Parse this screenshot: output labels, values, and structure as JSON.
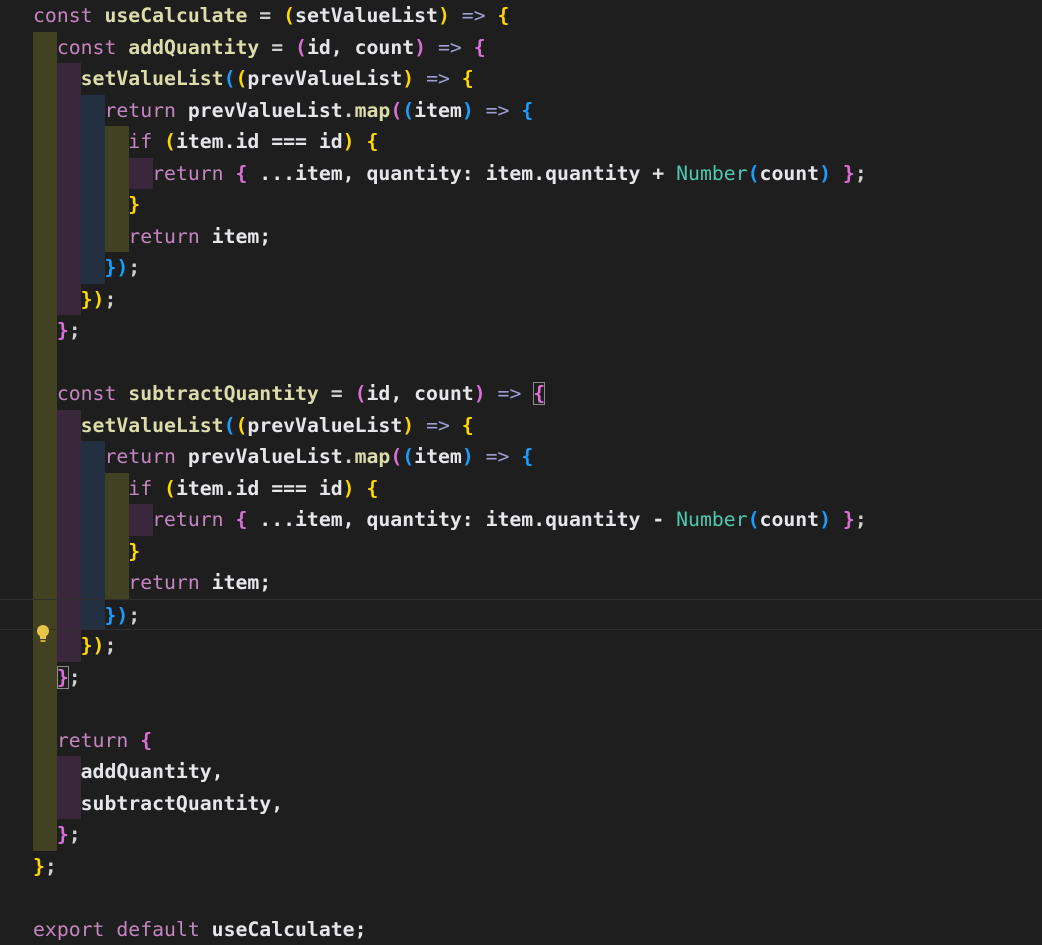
{
  "editor": {
    "lightbulb_icon": "lightbulb-icon",
    "current_line_index": 19,
    "lines": [
      [
        [
          "const ",
          "kw"
        ],
        [
          "useCalculate",
          "fn"
        ],
        [
          " = ",
          "op"
        ],
        [
          "(",
          "b1"
        ],
        [
          "setValueList",
          "id"
        ],
        [
          ")",
          "b1"
        ],
        [
          " => ",
          "arrow"
        ],
        [
          "{",
          "b1"
        ]
      ],
      [
        [
          "  ",
          "ws"
        ],
        [
          "const ",
          "kw"
        ],
        [
          "addQuantity",
          "fn"
        ],
        [
          " = ",
          "op"
        ],
        [
          "(",
          "b2"
        ],
        [
          "id, count",
          "id"
        ],
        [
          ")",
          "b2"
        ],
        [
          " => ",
          "arrow"
        ],
        [
          "{",
          "b2"
        ]
      ],
      [
        [
          "    ",
          "ws"
        ],
        [
          "setValueList",
          "fn"
        ],
        [
          "(",
          "b3"
        ],
        [
          "(",
          "b1"
        ],
        [
          "prevValueList",
          "id"
        ],
        [
          ")",
          "b1"
        ],
        [
          " => ",
          "arrow"
        ],
        [
          "{",
          "b1"
        ]
      ],
      [
        [
          "      ",
          "ws"
        ],
        [
          "return ",
          "kw"
        ],
        [
          "prevValueList",
          "id"
        ],
        [
          ".",
          "op"
        ],
        [
          "map",
          "fn"
        ],
        [
          "(",
          "b2"
        ],
        [
          "(",
          "b3"
        ],
        [
          "item",
          "id"
        ],
        [
          ")",
          "b3"
        ],
        [
          " => ",
          "arrow"
        ],
        [
          "{",
          "b3"
        ]
      ],
      [
        [
          "        ",
          "ws"
        ],
        [
          "if ",
          "kw"
        ],
        [
          "(",
          "b1"
        ],
        [
          "item.id === id",
          "id"
        ],
        [
          ")",
          "b1"
        ],
        [
          " ",
          "ws"
        ],
        [
          "{",
          "b1"
        ]
      ],
      [
        [
          "          ",
          "ws"
        ],
        [
          "return ",
          "kw"
        ],
        [
          "{",
          "b2"
        ],
        [
          " ...item, quantity: item.quantity + ",
          "id"
        ],
        [
          "Number",
          "cls"
        ],
        [
          "(",
          "b3"
        ],
        [
          "count",
          "id"
        ],
        [
          ")",
          "b3"
        ],
        [
          " ",
          "ws"
        ],
        [
          "}",
          "b2"
        ],
        [
          ";",
          "op"
        ]
      ],
      [
        [
          "        ",
          "ws"
        ],
        [
          "}",
          "b1"
        ]
      ],
      [
        [
          "        ",
          "ws"
        ],
        [
          "return ",
          "kw"
        ],
        [
          "item;",
          "id"
        ]
      ],
      [
        [
          "      ",
          "ws"
        ],
        [
          "})",
          "b3"
        ],
        [
          ";",
          "op"
        ]
      ],
      [
        [
          "    ",
          "ws"
        ],
        [
          "})",
          "b1"
        ],
        [
          ";",
          "op"
        ]
      ],
      [
        [
          "  ",
          "ws"
        ],
        [
          "}",
          "b2"
        ],
        [
          ";",
          "op"
        ]
      ],
      [],
      [
        [
          "  ",
          "ws"
        ],
        [
          "const ",
          "kw"
        ],
        [
          "subtractQuantity",
          "fn"
        ],
        [
          " = ",
          "op"
        ],
        [
          "(",
          "b2"
        ],
        [
          "id, count",
          "id"
        ],
        [
          ")",
          "b2"
        ],
        [
          " => ",
          "arrow"
        ],
        [
          "{",
          "b2-match"
        ]
      ],
      [
        [
          "    ",
          "ws"
        ],
        [
          "setValueList",
          "fn"
        ],
        [
          "(",
          "b3"
        ],
        [
          "(",
          "b1"
        ],
        [
          "prevValueList",
          "id"
        ],
        [
          ")",
          "b1"
        ],
        [
          " => ",
          "arrow"
        ],
        [
          "{",
          "b1"
        ]
      ],
      [
        [
          "      ",
          "ws"
        ],
        [
          "return ",
          "kw"
        ],
        [
          "prevValueList",
          "id"
        ],
        [
          ".",
          "op"
        ],
        [
          "map",
          "fn"
        ],
        [
          "(",
          "b2"
        ],
        [
          "(",
          "b3"
        ],
        [
          "item",
          "id"
        ],
        [
          ")",
          "b3"
        ],
        [
          " => ",
          "arrow"
        ],
        [
          "{",
          "b3"
        ]
      ],
      [
        [
          "        ",
          "ws"
        ],
        [
          "if ",
          "kw"
        ],
        [
          "(",
          "b1"
        ],
        [
          "item.id === id",
          "id"
        ],
        [
          ")",
          "b1"
        ],
        [
          " ",
          "ws"
        ],
        [
          "{",
          "b1"
        ]
      ],
      [
        [
          "          ",
          "ws"
        ],
        [
          "return ",
          "kw"
        ],
        [
          "{",
          "b2"
        ],
        [
          " ...item, quantity: item.quantity - ",
          "id"
        ],
        [
          "Number",
          "cls"
        ],
        [
          "(",
          "b3"
        ],
        [
          "count",
          "id"
        ],
        [
          ")",
          "b3"
        ],
        [
          " ",
          "ws"
        ],
        [
          "}",
          "b2"
        ],
        [
          ";",
          "op"
        ]
      ],
      [
        [
          "        ",
          "ws"
        ],
        [
          "}",
          "b1"
        ]
      ],
      [
        [
          "        ",
          "ws"
        ],
        [
          "return ",
          "kw"
        ],
        [
          "item;",
          "id"
        ]
      ],
      [
        [
          "      ",
          "ws"
        ],
        [
          "})",
          "b3"
        ],
        [
          ";",
          "op"
        ]
      ],
      [
        [
          "    ",
          "ws"
        ],
        [
          "})",
          "b1"
        ],
        [
          ";",
          "op"
        ]
      ],
      [
        [
          "  ",
          "ws"
        ],
        [
          "}",
          "b2-match"
        ],
        [
          ";",
          "op"
        ]
      ],
      [],
      [
        [
          "  ",
          "ws"
        ],
        [
          "return ",
          "kw"
        ],
        [
          "{",
          "b2"
        ]
      ],
      [
        [
          "    ",
          "ws"
        ],
        [
          "addQuantity,",
          "id"
        ]
      ],
      [
        [
          "    ",
          "ws"
        ],
        [
          "subtractQuantity,",
          "id"
        ]
      ],
      [
        [
          "  ",
          "ws"
        ],
        [
          "}",
          "b2"
        ],
        [
          ";",
          "op"
        ]
      ],
      [
        [
          "}",
          "b1"
        ],
        [
          ";",
          "op"
        ]
      ],
      [],
      [
        [
          "export ",
          "kw"
        ],
        [
          "default ",
          "kw"
        ],
        [
          "useCalculate;",
          "id"
        ]
      ]
    ]
  }
}
